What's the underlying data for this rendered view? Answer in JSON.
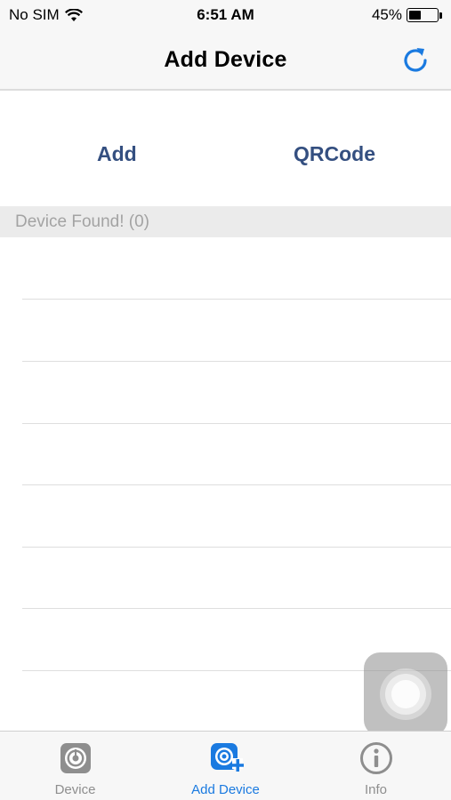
{
  "status_bar": {
    "carrier": "No SIM",
    "time": "6:51 AM",
    "battery_percent": "45%",
    "battery_level": 0.45
  },
  "nav": {
    "title": "Add Device",
    "refresh_icon": "refresh-icon"
  },
  "actions": {
    "add_label": "Add",
    "qrcode_label": "QRCode"
  },
  "section": {
    "header": "Device Found! (0)"
  },
  "device_list": [],
  "tabs": [
    {
      "label": "Device",
      "icon": "camera-icon",
      "active": false
    },
    {
      "label": "Add Device",
      "icon": "camera-add-icon",
      "active": true
    },
    {
      "label": "Info",
      "icon": "info-icon",
      "active": false
    }
  ],
  "colors": {
    "accent": "#1a7ae0",
    "action_text": "#344f80",
    "inactive": "#8e8e8e"
  }
}
